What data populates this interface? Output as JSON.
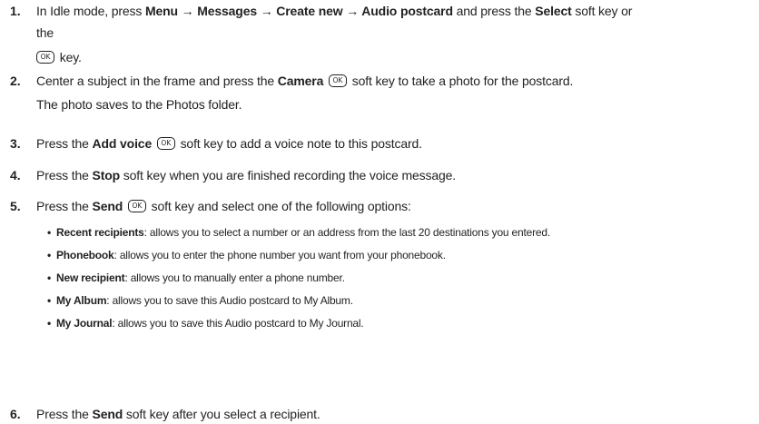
{
  "ok_key_label": "OK",
  "steps": [
    {
      "number": "1.",
      "line1_pre": "In Idle mode, press ",
      "menu_path": "Menu → Messages → Create new → Audio postcard",
      "line1_mid": " and press the ",
      "select_label": "Select",
      "line1_post": " soft key or",
      "line2": "the",
      "line3_post": " key."
    },
    {
      "number": "2.",
      "pre": "Center a subject in the frame and press the ",
      "key_label": "Camera",
      "post": " soft key to take a photo for the postcard.",
      "line2": "The photo saves to the Photos folder."
    },
    {
      "number": "3.",
      "pre": "Press the ",
      "key_label": "Add voice",
      "post": " soft key to add a voice note to this postcard."
    },
    {
      "number": "4.",
      "pre": "Press the ",
      "key_label": "Stop",
      "post": " soft key when you are finished recording the voice message."
    },
    {
      "number": "5.",
      "pre": "Press the ",
      "key_label": "Send",
      "post": " soft key and select one of the following options:",
      "options": [
        {
          "term": "Recent recipients",
          "desc": ": allows you to select a number or an address from the last 20 destinations you entered."
        },
        {
          "term": "Phonebook",
          "desc": ": allows you to enter the phone number you want from your phonebook."
        },
        {
          "term": "New recipient",
          "desc": ": allows you to manually enter a phone number."
        },
        {
          "term": "My Album",
          "desc": ": allows you to save this Audio postcard to My Album."
        },
        {
          "term": "My Journal",
          "desc": ": allows you to save this Audio postcard to My Journal."
        }
      ]
    },
    {
      "number": "6.",
      "pre": "Press the ",
      "key_label": "Send",
      "post": " soft key after you select a recipient."
    }
  ]
}
